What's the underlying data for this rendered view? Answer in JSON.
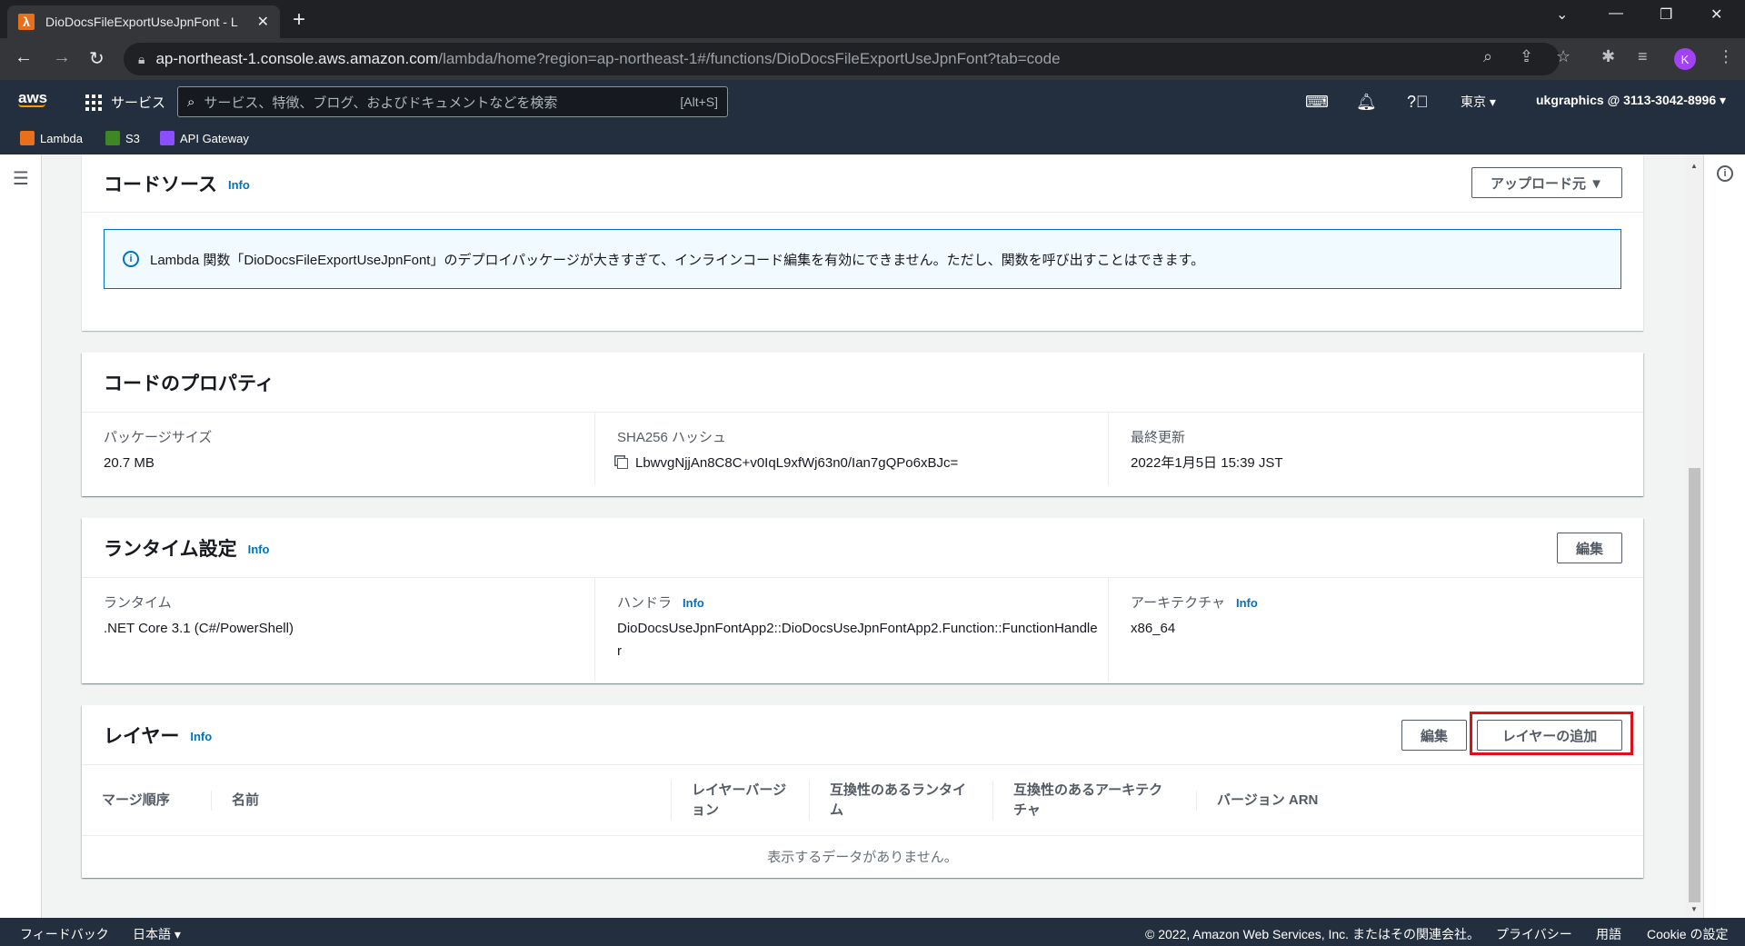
{
  "browser": {
    "tab_title": "DioDocsFileExportUseJpnFont - L",
    "url_host": "ap-northeast-1.console.aws.amazon.com",
    "url_path": "/lambda/home?region=ap-northeast-1#/functions/DioDocsFileExportUseJpnFont?tab=code",
    "profile_initial": "K"
  },
  "aws_header": {
    "logo": "aws",
    "services_label": "サービス",
    "search_placeholder": "サービス、特徴、ブログ、およびドキュメントなどを検索",
    "search_shortcut": "[Alt+S]",
    "region": "東京 ▾",
    "account": "ukgraphics @ 3113-3042-8996 ▾"
  },
  "favorites": [
    {
      "label": "Lambda",
      "color": "#e8701a"
    },
    {
      "label": "S3",
      "color": "#3f8624"
    },
    {
      "label": "API Gateway",
      "color": "#8c4fff"
    }
  ],
  "code_source": {
    "title": "コードソース",
    "info": "Info",
    "upload_button": "アップロード元 ▼",
    "alert_text": "Lambda 関数「DioDocsFileExportUseJpnFont」のデプロイパッケージが大きすぎて、インラインコード編集を有効にできません。ただし、関数を呼び出すことはできます。"
  },
  "code_properties": {
    "title": "コードのプロパティ",
    "package_size_label": "パッケージサイズ",
    "package_size_value": "20.7 MB",
    "sha_label": "SHA256 ハッシュ",
    "sha_value": "LbwvgNjjAn8C8C+v0IqL9xfWj63n0/Ian7gQPo6xBJc=",
    "last_modified_label": "最終更新",
    "last_modified_value": "2022年1月5日 15:39 JST"
  },
  "runtime_settings": {
    "title": "ランタイム設定",
    "info": "Info",
    "edit_button": "編集",
    "runtime_label": "ランタイム",
    "runtime_value": ".NET Core 3.1 (C#/PowerShell)",
    "handler_label": "ハンドラ",
    "handler_info": "Info",
    "handler_value": "DioDocsUseJpnFontApp2::DioDocsUseJpnFontApp2.Function::FunctionHandler",
    "arch_label": "アーキテクチャ",
    "arch_info": "Info",
    "arch_value": "x86_64"
  },
  "layers": {
    "title": "レイヤー",
    "info": "Info",
    "edit_button": "編集",
    "add_layer_button": "レイヤーの追加",
    "columns": [
      "マージ順序",
      "名前",
      "レイヤーバージョン",
      "互換性のあるランタイム",
      "互換性のあるアーキテクチャ",
      "バージョン ARN"
    ],
    "empty_text": "表示するデータがありません。"
  },
  "footer": {
    "feedback": "フィードバック",
    "language": "日本語 ▾",
    "copyright": "© 2022, Amazon Web Services, Inc. またはその関連会社。",
    "privacy": "プライバシー",
    "terms": "用語",
    "cookie": "Cookie の設定"
  },
  "colors": {
    "highlight": "#e0101a",
    "link": "#0073bb",
    "aws_header": "#232f3e"
  }
}
